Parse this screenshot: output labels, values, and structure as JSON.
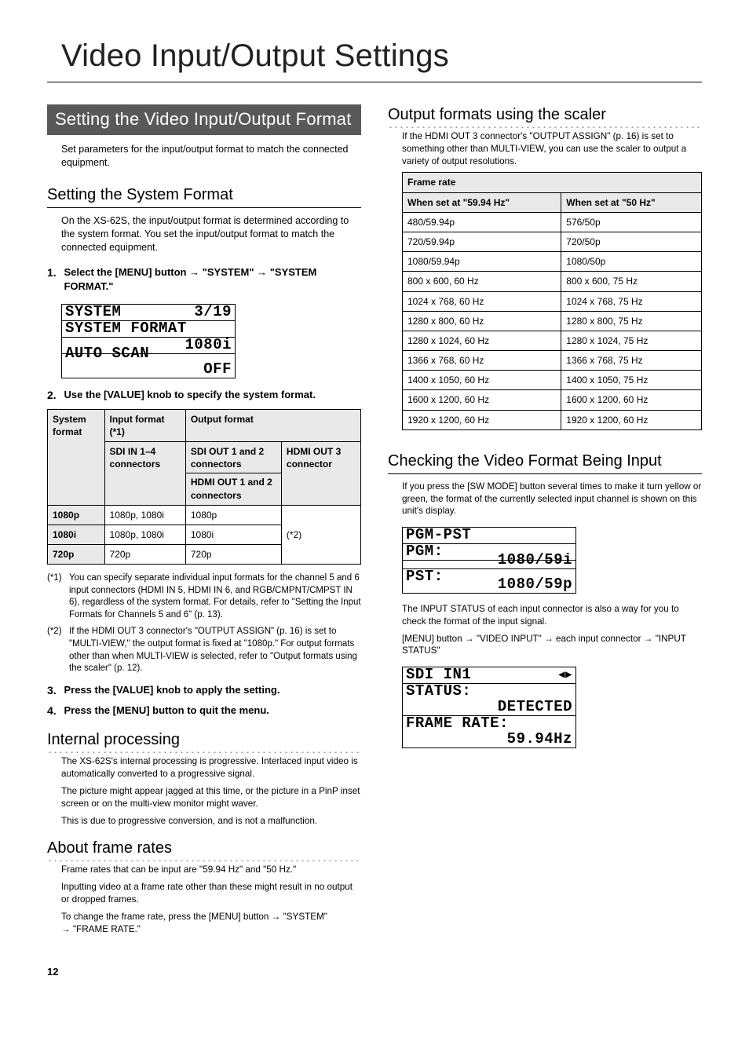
{
  "page": {
    "title": "Video Input/Output Settings",
    "number": "12"
  },
  "left": {
    "banner": "Setting the Video Input/Output Format",
    "intro": "Set parameters for the input/output format to match the connected equipment.",
    "h2_system_format": "Setting the System Format",
    "system_format_intro": "On the XS-62S, the input/output format is determined according to the system format. You set the input/output format to match the connected equipment.",
    "step1_num": "1.",
    "step1_a": "Select the [MENU] button ",
    "arrow": "→",
    "step1_b": "  \"SYSTEM\" ",
    "step1_c": " \"SYSTEM FORMAT.\"",
    "lcd1": {
      "r1a": "SYSTEM",
      "r1b": "3/19",
      "r2": "SYSTEM FORMAT",
      "r3": "1080i",
      "r4a": "AUTO SCAN",
      "r5": "OFF"
    },
    "step2_num": "2.",
    "step2": "Use the [VALUE] knob to specify the system format.",
    "table1": {
      "h_sys": "System format",
      "h_in": "Input format (*1)",
      "h_out": "Output format",
      "h_sdi_in": "SDI IN 1–4 connectors",
      "h_sdi_out": "SDI OUT 1 and 2 connectors",
      "h_hdmi12": "HDMI OUT 1 and 2 connectors",
      "h_hdmi3": "HDMI OUT 3 connector",
      "rows": [
        {
          "sys": "1080p",
          "in": "1080p, 1080i",
          "out": "1080p"
        },
        {
          "sys": "1080i",
          "in": "1080p, 1080i",
          "out": "1080i"
        },
        {
          "sys": "720p",
          "in": "720p",
          "out": "720p"
        }
      ],
      "star2": "(*2)"
    },
    "notes": [
      {
        "k": "(*1)",
        "v": "You can specify separate individual input formats for the channel 5 and 6 input connectors (HDMI IN 5, HDMI IN 6, and RGB/CMPNT/CMPST IN 6), regardless of the system format. For details, refer to \"Setting the Input Formats for Channels 5 and 6\" (p. 13)."
      },
      {
        "k": "(*2)",
        "v": "If the HDMI OUT 3 connector's \"OUTPUT ASSIGN\" (p. 16) is set to \"MULTI-VIEW,\" the output format is fixed at \"1080p.\" For output formats other than when MULTI-VIEW is selected, refer to \"Output formats using the scaler\" (p. 12)."
      }
    ],
    "step3_num": "3.",
    "step3": "Press the [VALUE] knob to apply the setting.",
    "step4_num": "4.",
    "step4": "Press the [MENU] button to quit the menu.",
    "h3_internal": "Internal processing",
    "internal_p1": "The XS-62S's internal processing is progressive. Interlaced input video is automatically converted to a progressive signal.",
    "internal_p2": "The picture might appear jagged at this time, or the picture in a PinP inset screen or on the multi-view monitor might waver.",
    "internal_p3": "This is due to progressive conversion, and is not a malfunction.",
    "h3_frame": "About frame rates",
    "frame_p1": "Frame rates that can be input are \"59.94 Hz\" and \"50 Hz.\"",
    "frame_p2": "Inputting video at a frame rate other than these might result in no output or dropped frames.",
    "frame_p3a": "To change the frame rate, press the [MENU] button ",
    "frame_p3b": " \"SYSTEM\" ",
    "frame_p3c": " \"FRAME RATE.\""
  },
  "right": {
    "h3_scaler": "Output formats using the scaler",
    "scaler_intro": "If the HDMI OUT 3 connector's \"OUTPUT ASSIGN\" (p. 16) is set to something other than MULTI-VIEW, you can use the scaler to output a variety of output resolutions.",
    "frame_table": {
      "header": "Frame rate",
      "col59": "When set at \"59.94 Hz\"",
      "col50": "When set at \"50 Hz\"",
      "rows": [
        [
          "480/59.94p",
          "576/50p"
        ],
        [
          "720/59.94p",
          "720/50p"
        ],
        [
          "1080/59.94p",
          "1080/50p"
        ],
        [
          "800 x 600, 60 Hz",
          "800 x 600, 75 Hz"
        ],
        [
          "1024 x 768, 60 Hz",
          "1024 x 768, 75 Hz"
        ],
        [
          "1280 x 800, 60 Hz",
          "1280 x 800, 75 Hz"
        ],
        [
          "1280 x 1024, 60 Hz",
          "1280 x 1024, 75 Hz"
        ],
        [
          "1366 x 768, 60 Hz",
          "1366 x 768, 75 Hz"
        ],
        [
          "1400 x 1050, 60 Hz",
          "1400 x 1050, 75 Hz"
        ],
        [
          "1600 x 1200, 60 Hz",
          "1600 x 1200, 60 Hz"
        ],
        [
          "1920 x 1200, 60 Hz",
          "1920 x 1200, 60 Hz"
        ]
      ]
    },
    "h2_checking": "Checking the Video Format Being Input",
    "checking_p1": "If you press the [SW MODE] button several times to make it turn yellow or green, the format of the currently selected input channel is shown on this unit's display.",
    "lcd2": {
      "r1": "PGM-PST",
      "r2a": "PGM:",
      "r2b": "1080/59i",
      "r3a": "PST:",
      "r3b": "1080/59p"
    },
    "checking_p2": "The INPUT STATUS of each input connector is also a way for you to check the format of the input signal.",
    "checking_p3a": "[MENU] button ",
    "checking_p3b": " \"VIDEO INPUT\" ",
    "checking_p3c": " each input connector ",
    "checking_p3d": " \"INPUT STATUS\"",
    "lcd3": {
      "r1a": "SDI IN1",
      "r1b_icon": "◀▶",
      "r2": "STATUS:",
      "r3": "DETECTED",
      "r4": "FRAME RATE:",
      "r5": "59.94Hz"
    }
  },
  "chart_data": {
    "type": "table",
    "title": "Frame rate output formats via scaler",
    "columns": [
      "When set at 59.94 Hz",
      "When set at 50 Hz"
    ],
    "rows": [
      [
        "480/59.94p",
        "576/50p"
      ],
      [
        "720/59.94p",
        "720/50p"
      ],
      [
        "1080/59.94p",
        "1080/50p"
      ],
      [
        "800 x 600, 60 Hz",
        "800 x 600, 75 Hz"
      ],
      [
        "1024 x 768, 60 Hz",
        "1024 x 768, 75 Hz"
      ],
      [
        "1280 x 800, 60 Hz",
        "1280 x 800, 75 Hz"
      ],
      [
        "1280 x 1024, 60 Hz",
        "1280 x 1024, 75 Hz"
      ],
      [
        "1366 x 768, 60 Hz",
        "1366 x 768, 75 Hz"
      ],
      [
        "1400 x 1050, 60 Hz",
        "1400 x 1050, 75 Hz"
      ],
      [
        "1600 x 1200, 60 Hz",
        "1600 x 1200, 60 Hz"
      ],
      [
        "1920 x 1200, 60 Hz",
        "1920 x 1200, 60 Hz"
      ]
    ]
  }
}
